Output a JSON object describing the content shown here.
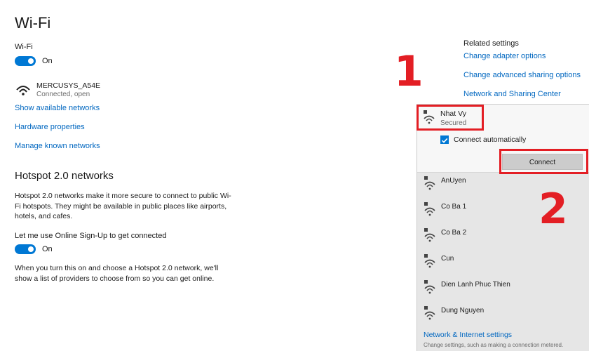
{
  "page": {
    "title": "Wi-Fi"
  },
  "wifi": {
    "label": "Wi-Fi",
    "toggle_state": "On"
  },
  "current_network": {
    "name": "MERCUSYS_A54E",
    "status": "Connected, open"
  },
  "links": {
    "show_networks": "Show available networks",
    "hardware": "Hardware properties",
    "manage_known": "Manage known networks"
  },
  "hotspot": {
    "heading": "Hotspot 2.0 networks",
    "description": "Hotspot 2.0 networks make it more secure to connect to public Wi-Fi hotspots. They might be available in public places like airports, hotels, and cafes.",
    "signup_label": "Let me use Online Sign-Up to get connected",
    "signup_toggle": "On",
    "note": "When you turn this on and choose a Hotspot 2.0 network, we'll show a list of providers to choose from so you can get online."
  },
  "related": {
    "heading": "Related settings",
    "adapter": "Change adapter options",
    "sharing": "Change advanced sharing options",
    "center": "Network and Sharing Center"
  },
  "flyout": {
    "selected": {
      "name": "Nhat Vy",
      "status": "Secured"
    },
    "connect_auto_label": "Connect automatically",
    "connect_button": "Connect",
    "networks": [
      "AnUyen",
      "Co Ba 1",
      "Co Ba 2",
      "Cun",
      "Dien Lanh Phuc Thien",
      "Dung Nguyen"
    ],
    "footer_link": "Network & Internet settings",
    "footer_text": "Change settings, such as making a connection metered."
  },
  "annotations": {
    "step1": "1",
    "step2": "2"
  },
  "colors": {
    "accent": "#0078d4",
    "link": "#0067c0",
    "annotation_red": "#e31e24"
  }
}
